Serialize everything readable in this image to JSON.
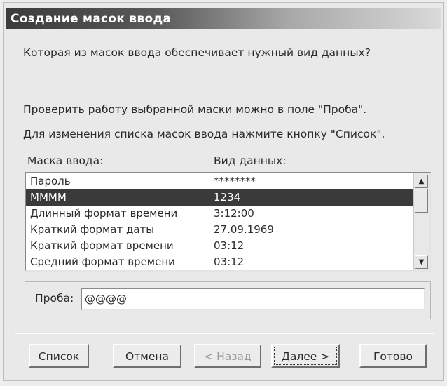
{
  "window": {
    "title": "Создание масок ввода"
  },
  "content": {
    "question": "Которая из масок ввода обеспечивает нужный вид данных?",
    "check_hint": "Проверить работу выбранной маски можно в поле \"Проба\".",
    "change_hint": "Для изменения списка масок ввода нажмите кнопку \"Список\".",
    "col_mask": "Маска ввода:",
    "col_view": "Вид данных:"
  },
  "list": {
    "rows": [
      {
        "mask": "Пароль",
        "view": "********"
      },
      {
        "mask": "MMMM",
        "view": "1234"
      },
      {
        "mask": "Длинный формат времени",
        "view": "3:12:00"
      },
      {
        "mask": "Краткий формат даты",
        "view": "27.09.1969"
      },
      {
        "mask": "Краткий формат времени",
        "view": "03:12"
      },
      {
        "mask": "Средний формат времени",
        "view": "03:12"
      }
    ],
    "selected_index": 1
  },
  "test": {
    "label": "Проба:",
    "value": "@@@@"
  },
  "buttons": {
    "list": "Список",
    "cancel": "Отмена",
    "back": "< Назад",
    "next": "Далее >",
    "done": "Готово"
  },
  "icons": {
    "scroll_up": "scroll-up-arrow-icon",
    "scroll_down": "scroll-down-arrow-icon"
  }
}
